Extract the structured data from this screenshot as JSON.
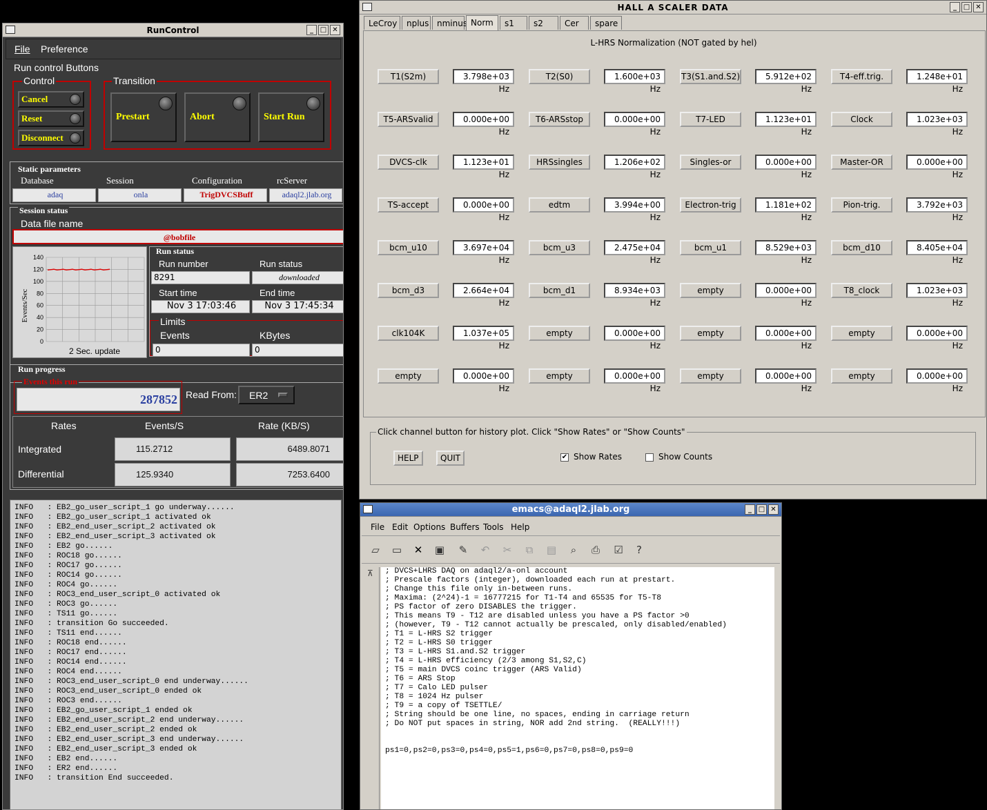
{
  "runcontrol": {
    "title": "RunControl",
    "menu": {
      "file": "File",
      "preference": "Preference"
    },
    "run_control_buttons": "Run control Buttons",
    "control_label": "Control",
    "transition_label": "Transition",
    "control_buttons": [
      "Cancel",
      "Reset",
      "Disconnect"
    ],
    "transition_buttons": [
      "Prestart",
      "Abort",
      "Start Run"
    ],
    "static_parameters": "Static parameters",
    "params": {
      "database_label": "Database",
      "database": "adaq",
      "session_label": "Session",
      "session": "onla",
      "configuration_label": "Configuration",
      "configuration": "TrigDVCSBuff",
      "rcserver_label": "rcServer",
      "rcserver": "adaql2.jlab.org"
    },
    "session_status": "Session status",
    "data_file_label": "Data file name",
    "data_file": "@bobfile",
    "chart": {
      "ylabel": "Events/Sec",
      "caption": "2 Sec. update",
      "ticks": [
        "140",
        "120",
        "100",
        "80",
        "60",
        "40",
        "20",
        "0"
      ]
    },
    "run_status_header": "Run status",
    "run_number_label": "Run number",
    "run_number": "8291",
    "run_status_label": "Run status",
    "run_status": "downloaded",
    "start_time_label": "Start time",
    "start_time": "Nov 3 17:03:46",
    "end_time_label": "End time",
    "end_time": "Nov 3 17:45:34",
    "limits_label": "Limits",
    "events_label": "Events",
    "events_limit": "0",
    "kbytes_label": "KBytes",
    "kbytes_limit": "0",
    "run_progress": "Run progress",
    "events_this_run_label": "Events this run",
    "events_this_run": "287852",
    "read_from_label": "Read From:",
    "read_from": "ER2",
    "rates_header": [
      "Rates",
      "Events/S",
      "Rate (KB/S)"
    ],
    "integrated_label": "Integrated",
    "integrated_events": "115.2712",
    "integrated_rate": "6489.8071",
    "differential_label": "Differential",
    "differential_events": "125.9340",
    "differential_rate": "7253.6400",
    "log": [
      "INFO   : EB2_go_user_script_1 go underway......",
      "INFO   : EB2_go_user_script_1 activated ok",
      "INFO   : EB2_end_user_script_2 activated ok",
      "INFO   : EB2_end_user_script_3 activated ok",
      "INFO   : EB2 go......",
      "INFO   : ROC18 go......",
      "INFO   : ROC17 go......",
      "INFO   : ROC14 go......",
      "INFO   : ROC4 go......",
      "INFO   : ROC3_end_user_script_0 activated ok",
      "INFO   : ROC3 go......",
      "INFO   : TS11 go......",
      "INFO   : transition Go succeeded.",
      "INFO   : TS11 end......",
      "INFO   : ROC18 end......",
      "INFO   : ROC17 end......",
      "INFO   : ROC14 end......",
      "INFO   : ROC4 end......",
      "INFO   : ROC3_end_user_script_0 end underway......",
      "INFO   : ROC3_end_user_script_0 ended ok",
      "INFO   : ROC3 end......",
      "INFO   : EB2_go_user_script_1 ended ok",
      "INFO   : EB2_end_user_script_2 end underway......",
      "INFO   : EB2_end_user_script_2 ended ok",
      "INFO   : EB2_end_user_script_3 end underway......",
      "INFO   : EB2_end_user_script_3 ended ok",
      "INFO   : EB2 end......",
      "INFO   : ER2 end......",
      "INFO   : transition End succeeded."
    ]
  },
  "scaler": {
    "title": "HALL  A   SCALER   DATA",
    "tabs": [
      "LeCroy",
      "nplus",
      "nminus",
      "Norm",
      "s1",
      "s2",
      "Cer",
      "spare"
    ],
    "active_tab": "Norm",
    "heading": "L-HRS Normalization (NOT gated by hel)",
    "channels": [
      [
        [
          "T1(S2m)",
          "3.798e+03 Hz"
        ],
        [
          "T2(S0)",
          "1.600e+03 Hz"
        ],
        [
          "T3(S1.and.S2)",
          "5.912e+02 Hz"
        ],
        [
          "T4-eff.trig.",
          "1.248e+01 Hz"
        ]
      ],
      [
        [
          "T5-ARSvalid",
          "0.000e+00 Hz"
        ],
        [
          "T6-ARSstop",
          "0.000e+00 Hz"
        ],
        [
          "T7-LED",
          "1.123e+01 Hz"
        ],
        [
          "Clock",
          "1.023e+03 Hz"
        ]
      ],
      [
        [
          "DVCS-clk",
          "1.123e+01 Hz"
        ],
        [
          "HRSsingles",
          "1.206e+02 Hz"
        ],
        [
          "Singles-or",
          "0.000e+00 Hz"
        ],
        [
          "Master-OR",
          "0.000e+00 Hz"
        ]
      ],
      [
        [
          "TS-accept",
          "0.000e+00 Hz"
        ],
        [
          "edtm",
          "3.994e+00 Hz"
        ],
        [
          "Electron-trig",
          "1.181e+02 Hz"
        ],
        [
          "Pion-trig.",
          "3.792e+03 Hz"
        ]
      ],
      [
        [
          "bcm_u10",
          "3.697e+04 Hz"
        ],
        [
          "bcm_u3",
          "2.475e+04 Hz"
        ],
        [
          "bcm_u1",
          "8.529e+03 Hz"
        ],
        [
          "bcm_d10",
          "8.405e+04 Hz"
        ]
      ],
      [
        [
          "bcm_d3",
          "2.664e+04 Hz"
        ],
        [
          "bcm_d1",
          "8.934e+03 Hz"
        ],
        [
          "empty",
          "0.000e+00 Hz"
        ],
        [
          "T8_clock",
          "1.023e+03 Hz"
        ]
      ],
      [
        [
          "clk104K",
          "1.037e+05 Hz"
        ],
        [
          "empty",
          "0.000e+00 Hz"
        ],
        [
          "empty",
          "0.000e+00 Hz"
        ],
        [
          "empty",
          "0.000e+00 Hz"
        ]
      ],
      [
        [
          "empty",
          "0.000e+00 Hz"
        ],
        [
          "empty",
          "0.000e+00 Hz"
        ],
        [
          "empty",
          "0.000e+00 Hz"
        ],
        [
          "empty",
          "0.000e+00 Hz"
        ]
      ]
    ],
    "footer_label": "Click channel button for history plot.  Click \"Show Rates\" or \"Show Counts\"",
    "help": "HELP",
    "quit": "QUIT",
    "show_rates": "Show Rates",
    "show_counts": "Show Counts",
    "show_rates_checked": true,
    "show_counts_checked": false
  },
  "emacs": {
    "title": "emacs@adaql2.jlab.org",
    "menus": [
      "File",
      "Edit",
      "Options",
      "Buffers",
      "Tools",
      "Help"
    ],
    "buffer_lines": [
      "; DVCS+LHRS DAQ on adaql2/a-onl account",
      "; Prescale factors (integer), downloaded each run at prestart.",
      "; Change this file only in-between runs.",
      "; Maxima: (2^24)-1 = 16777215 for T1-T4 and 65535 for T5-T8",
      "; PS factor of zero DISABLES the trigger.",
      "; This means T9 - T12 are disabled unless you have a PS factor >0",
      "; (however, T9 - T12 cannot actually be prescaled, only disabled/enabled)",
      "; T1 = L-HRS S2 trigger",
      "; T2 = L-HRS S0 trigger",
      "; T3 = L-HRS S1.and.S2 trigger",
      "; T4 = L-HRS efficiency (2/3 among S1,S2,C)",
      "; T5 = main DVCS coinc trigger (ARS Valid)",
      "; T6 = ARS Stop",
      "; T7 = Calo LED pulser",
      "; T8 = 1024 Hz pulser",
      "; T9 = a copy of TSETTLE/",
      "; String should be one line, no spaces, ending in carriage return",
      "; Do NOT put spaces in string, NOR add 2nd string.  (REALLY!!!)",
      "",
      "",
      "ps1=0,ps2=0,ps3=0,ps4=0,ps5=1,ps6=0,ps7=0,ps8=0,ps9=0"
    ]
  }
}
